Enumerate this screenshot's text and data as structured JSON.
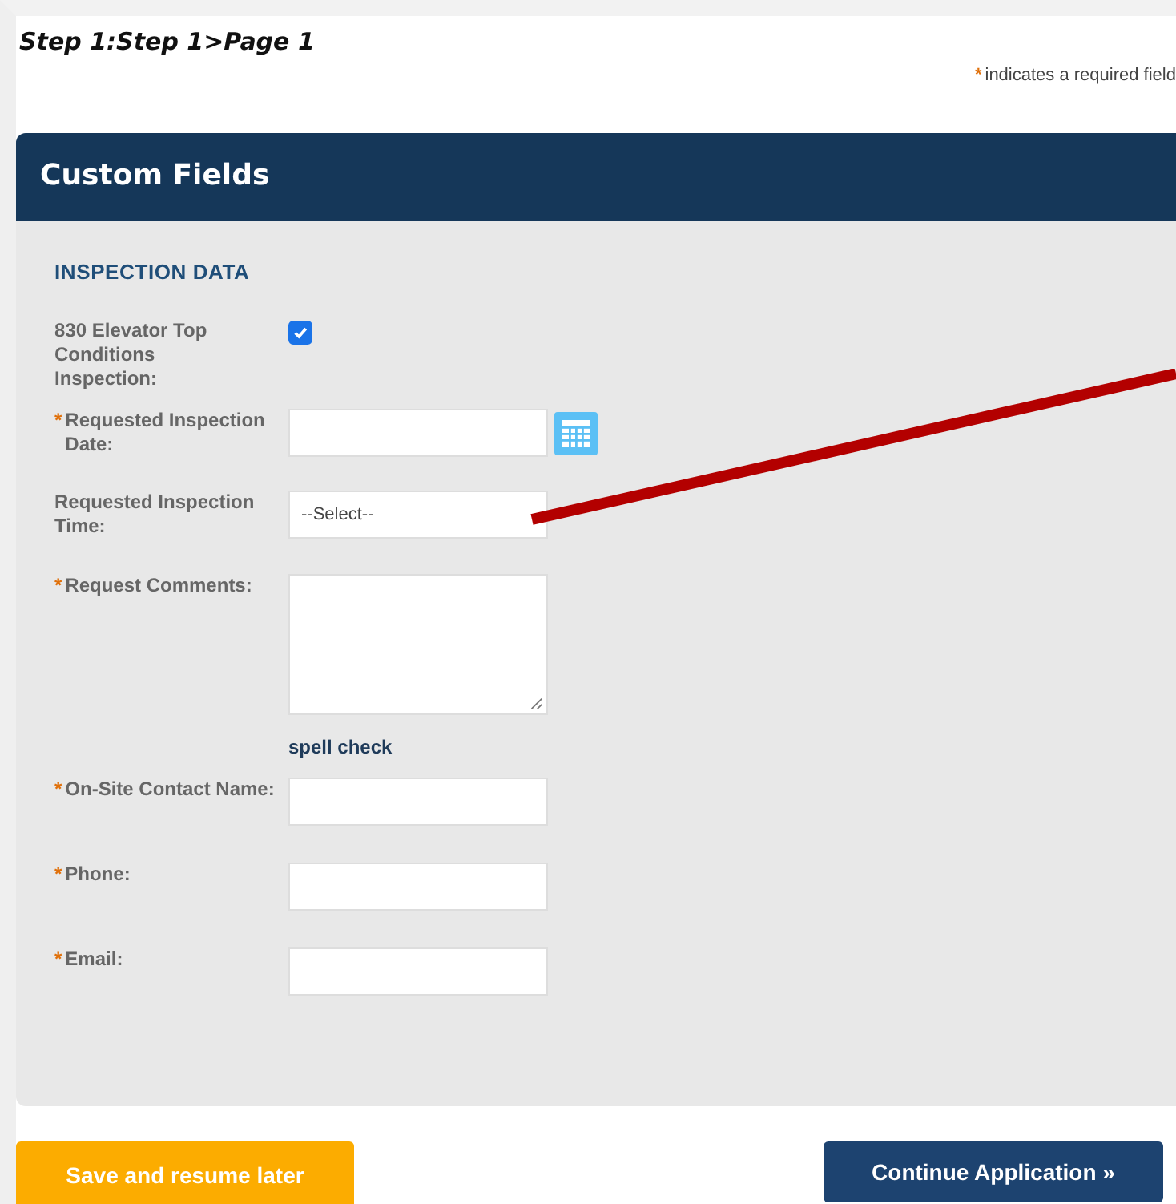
{
  "breadcrumb": "Step 1:Step 1>Page 1",
  "required_note": {
    "mark": "*",
    "text": "indicates a required field"
  },
  "panel": {
    "title": "Custom Fields",
    "section": "INSPECTION DATA",
    "fields": [
      {
        "kind": "checkbox",
        "label": "830 Elevator Top Conditions Inspection:",
        "required": false,
        "checked": true
      },
      {
        "kind": "date",
        "label": "Requested Inspection Date:",
        "required": true
      },
      {
        "kind": "select",
        "label": "Requested Inspection Time:",
        "required": false,
        "value": "--Select--"
      },
      {
        "kind": "textarea",
        "label": "Request Comments:",
        "required": true,
        "link": "spell check"
      },
      {
        "kind": "text",
        "label": "On-Site Contact Name:",
        "required": true
      },
      {
        "kind": "text",
        "label": "Phone:",
        "required": true
      },
      {
        "kind": "text",
        "label": "Email:",
        "required": true
      }
    ]
  },
  "buttons": {
    "save": "Save and resume later",
    "continue": "Continue Application »"
  }
}
